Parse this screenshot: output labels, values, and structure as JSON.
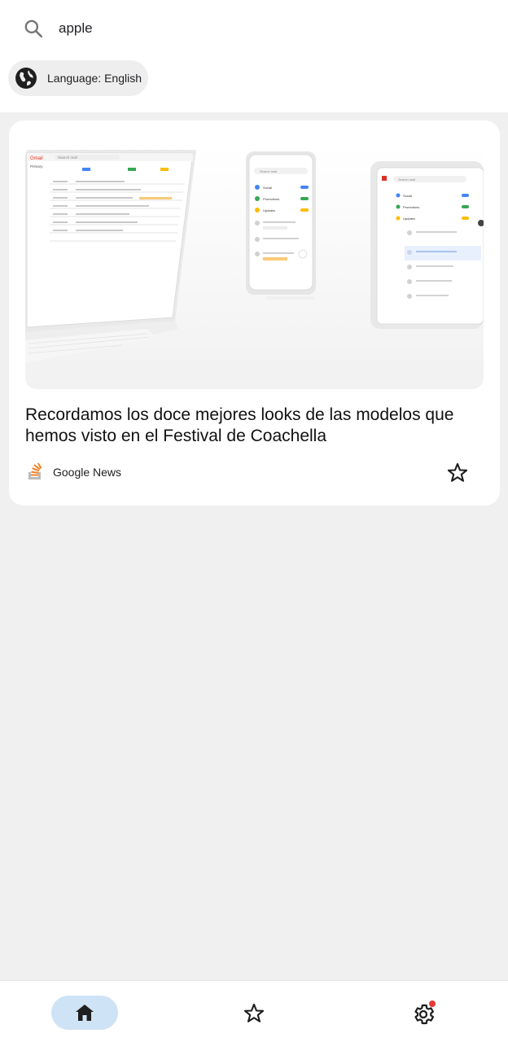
{
  "search": {
    "value": "apple",
    "icon": "search-icon"
  },
  "language_chip": {
    "label": "Language: English",
    "icon": "globe-icon"
  },
  "article": {
    "title": "Recordamos los doce mejores looks de las modelos que hemos visto en el Festival de Coachella",
    "source": "Google News",
    "image_screen_text": {
      "laptop_app": "Gmail",
      "laptop_search": "Search mail",
      "laptop_folder": "Primary",
      "phone_search": "Search mail",
      "tablet_search": "Search mail",
      "categories": [
        "Social",
        "Promotions",
        "Updates"
      ]
    }
  },
  "bottom_nav": {
    "items": [
      {
        "name": "home",
        "icon": "home-icon",
        "active": true
      },
      {
        "name": "favorites",
        "icon": "star-outline-icon",
        "active": false
      },
      {
        "name": "settings",
        "icon": "gear-icon",
        "active": false,
        "badge": true
      }
    ]
  },
  "colors": {
    "background": "#f0f0f0",
    "surface": "#ffffff",
    "chip": "#eeeeee",
    "active_nav": "#cfe3f6",
    "badge": "#e53935",
    "source_icon_orange": "#f48024"
  }
}
